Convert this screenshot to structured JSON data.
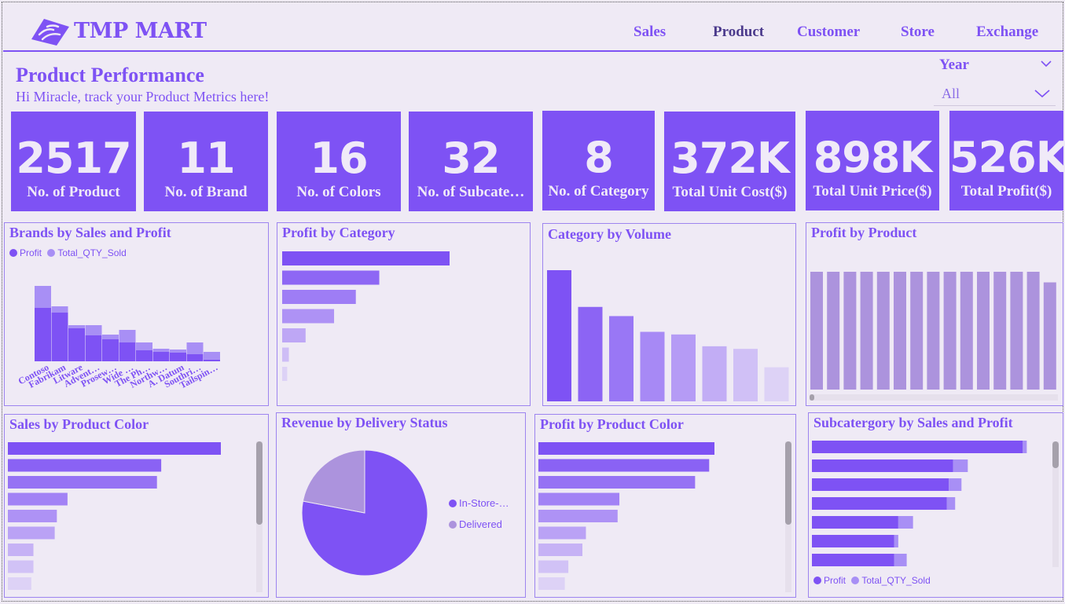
{
  "brand": {
    "name": "TMP MART",
    "logo_icon": "tmp-mart-logo-icon"
  },
  "nav": [
    {
      "label": "Sales",
      "active": false
    },
    {
      "label": "Product",
      "active": true
    },
    {
      "label": "Customer",
      "active": false
    },
    {
      "label": "Store",
      "active": false
    },
    {
      "label": "Exchange",
      "active": false
    }
  ],
  "page": {
    "title": "Product Performance",
    "subtitle": "Hi Miracle, track your Product Metrics here!"
  },
  "slicer": {
    "label": "Year",
    "value": "All",
    "icon": "chevron-down-icon"
  },
  "kpis": [
    {
      "value": "2517",
      "label": "No. of Product"
    },
    {
      "value": "11",
      "label": "No. of Brand"
    },
    {
      "value": "16",
      "label": "No. of Colors"
    },
    {
      "value": "32",
      "label": "No. of Subcate…"
    },
    {
      "value": "8",
      "label": "No. of Category"
    },
    {
      "value": "372K",
      "label": "Total Unit Cost($)"
    },
    {
      "value": "898K",
      "label": "Total Unit Price($)"
    },
    {
      "value": "526K",
      "label": "Total Profit($)"
    }
  ],
  "colors": {
    "accent": "#7e52f4",
    "light": "#a88ff5",
    "background": "#efeaf5"
  },
  "chart_data": [
    {
      "title": "Brands by Sales and Profit",
      "type": "bar",
      "categories": [
        "Contoso",
        "Fabrikam",
        "Litware",
        "Advent…",
        "Prosew…",
        "Wide …",
        "The Ph…",
        "Northw…",
        "A. Datum",
        "Southri…",
        "Tailspin…"
      ],
      "series": [
        {
          "name": "Profit",
          "values": [
            68,
            62,
            42,
            33,
            28,
            24,
            14,
            12,
            11,
            9,
            2
          ]
        },
        {
          "name": "Total_QTY_Sold",
          "values": [
            28,
            8,
            4,
            13,
            6,
            16,
            10,
            4,
            4,
            15,
            10
          ]
        }
      ],
      "legend": "top-left"
    },
    {
      "title": "Profit by Category",
      "type": "bar",
      "orientation": "horizontal",
      "values": [
        100,
        58,
        44,
        31,
        14,
        4,
        3
      ]
    },
    {
      "title": "Category by Volume",
      "type": "bar",
      "values": [
        100,
        72,
        65,
        53,
        51,
        42,
        40,
        26
      ]
    },
    {
      "title": "Profit by Product",
      "type": "bar",
      "values": [
        100,
        100,
        100,
        100,
        100,
        100,
        100,
        100,
        100,
        100,
        100,
        100,
        100,
        100,
        91
      ]
    },
    {
      "title": "Sales by Product Color",
      "type": "bar",
      "orientation": "horizontal",
      "values": [
        100,
        72,
        70,
        28,
        23,
        22,
        12,
        12,
        11
      ]
    },
    {
      "title": "Revenue by Delivery Status",
      "type": "pie",
      "series": [
        {
          "name": "In-Store-…",
          "value": 78
        },
        {
          "name": "Delivered",
          "value": 22
        }
      ],
      "legend": "right"
    },
    {
      "title": "Profit by Product Color",
      "type": "bar",
      "orientation": "horizontal",
      "values": [
        100,
        97,
        89,
        46,
        45,
        27,
        25,
        17,
        15
      ]
    },
    {
      "title": "Subcatergory by Sales and Profit",
      "type": "bar",
      "orientation": "horizontal",
      "series": [
        {
          "name": "Profit",
          "values": [
            100,
            67,
            65,
            64,
            41,
            39,
            39
          ]
        },
        {
          "name": "Total_QTY_Sold",
          "values": [
            2,
            7,
            6,
            4,
            7,
            2,
            6
          ]
        }
      ],
      "legend": "bottom-left"
    }
  ]
}
